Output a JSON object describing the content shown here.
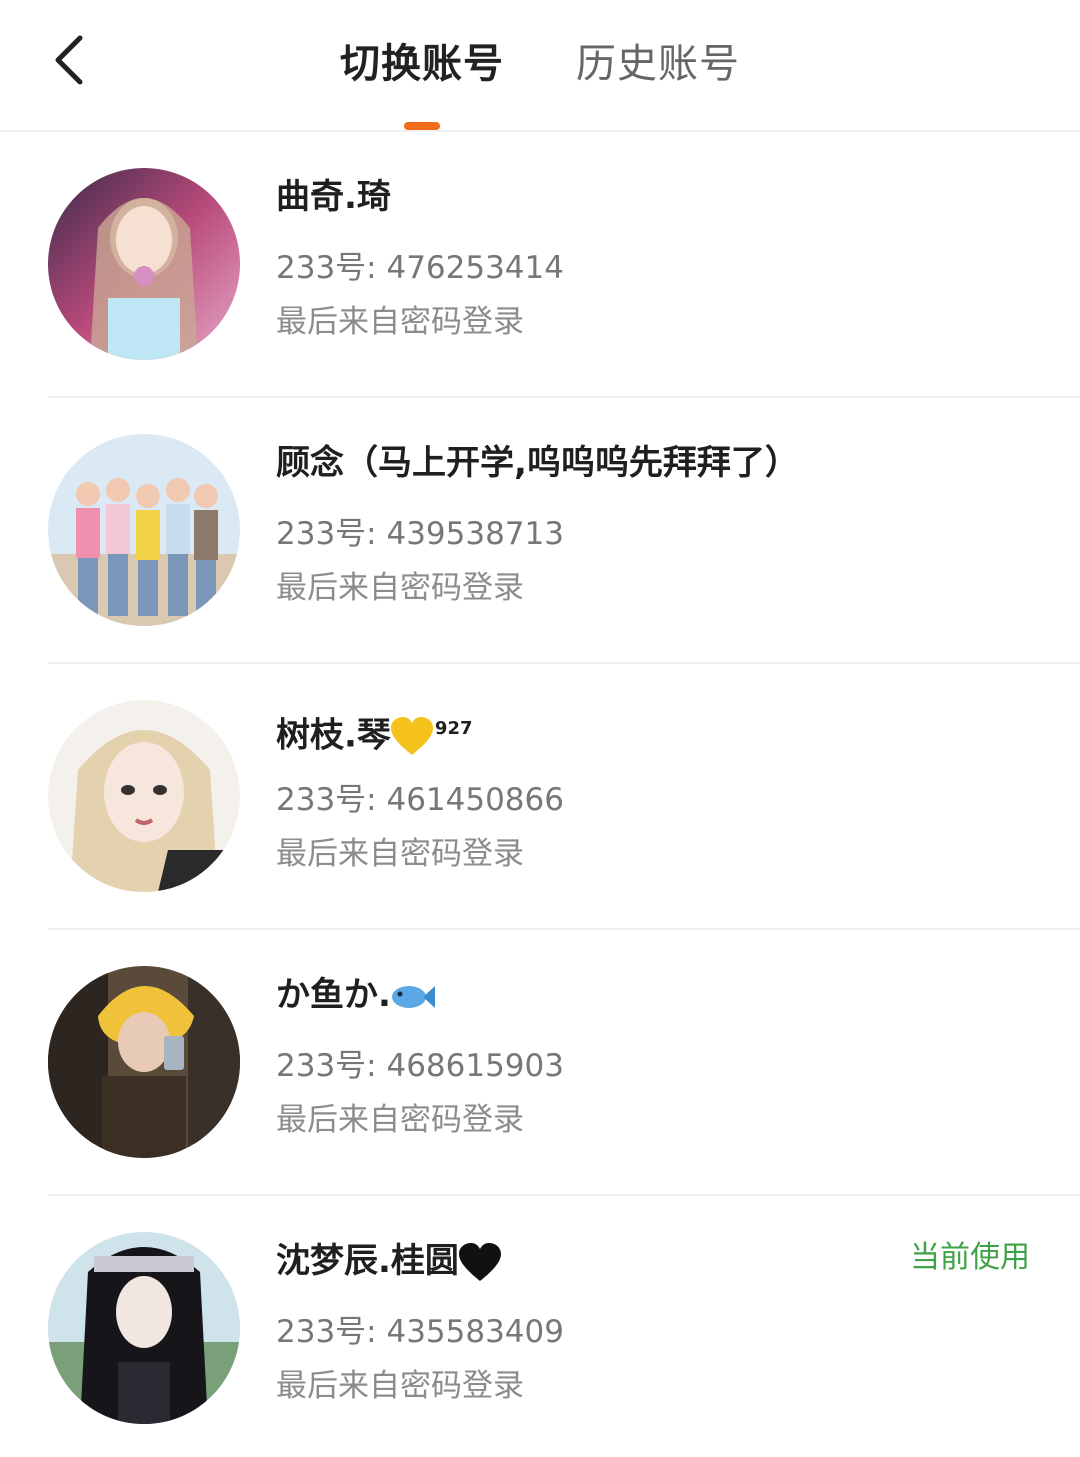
{
  "header": {
    "back_icon": "chevron-left-icon",
    "tabs": [
      {
        "label": "切换账号",
        "active": true
      },
      {
        "label": "历史账号",
        "active": false
      }
    ],
    "indicator_color": "#f26b1d"
  },
  "accounts": [
    {
      "name": "曲奇.琦",
      "uid": "233号: 476253414",
      "login": "最后来自密码登录"
    },
    {
      "name": "顾念（马上开学,呜呜呜先拜拜了）",
      "uid": "233号: 439538713",
      "login": "最后来自密码登录"
    },
    {
      "name": "树枝.琴",
      "name_sup": "927",
      "name_emoji": "yellow-heart-icon",
      "uid": "233号: 461450866",
      "login": "最后来自密码登录"
    },
    {
      "name": "か鱼か.",
      "name_emoji": "fish-icon",
      "uid": "233号: 468615903",
      "login": "最后来自密码登录"
    },
    {
      "name": "沈梦辰.桂圆",
      "name_emoji": "black-heart-icon",
      "uid": "233号: 435583409",
      "login": "最后来自密码登录",
      "badge": "当前使用"
    }
  ],
  "colors": {
    "current_badge": "#3fa247",
    "primary_text": "#1f1f1f",
    "secondary_text": "#777777"
  }
}
